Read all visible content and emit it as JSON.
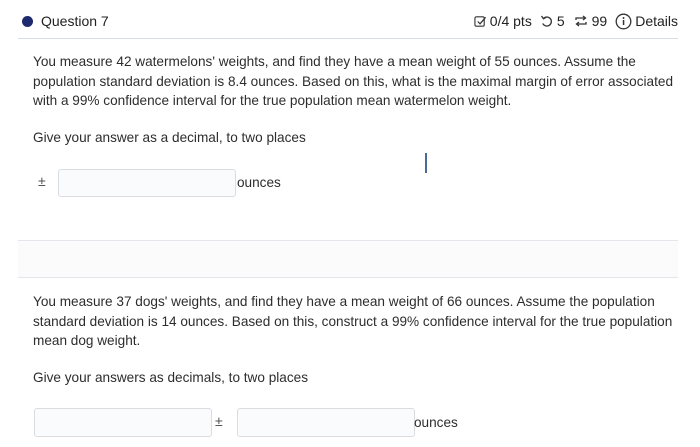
{
  "header": {
    "question_label": "Question 7",
    "points": "0/4 pts",
    "attempts": "5",
    "regenerations": "99",
    "details_label": "Details"
  },
  "question1": {
    "text": "You measure 42 watermelons' weights, and find they have a mean weight of 55 ounces. Assume the population standard deviation is 8.4 ounces. Based on this, what is the maximal margin of error associated with a 99% confidence interval for the true population mean watermelon weight.",
    "instruction": "Give your answer as a decimal, to two places",
    "prefix": "±",
    "input_value": "",
    "unit": "ounces"
  },
  "question2": {
    "text": "You measure 37 dogs' weights, and find they have a mean weight of 66 ounces. Assume the population standard deviation is 14 ounces. Based on this, construct a 99% confidence interval for the true population mean dog weight.",
    "instruction": "Give your answers as decimals, to two places",
    "input1_value": "",
    "separator": "±",
    "input2_value": "",
    "unit": "ounces"
  },
  "colors": {
    "dot": "#1d2a6f",
    "border": "#d9dde2",
    "text": "#2d2d2d"
  }
}
